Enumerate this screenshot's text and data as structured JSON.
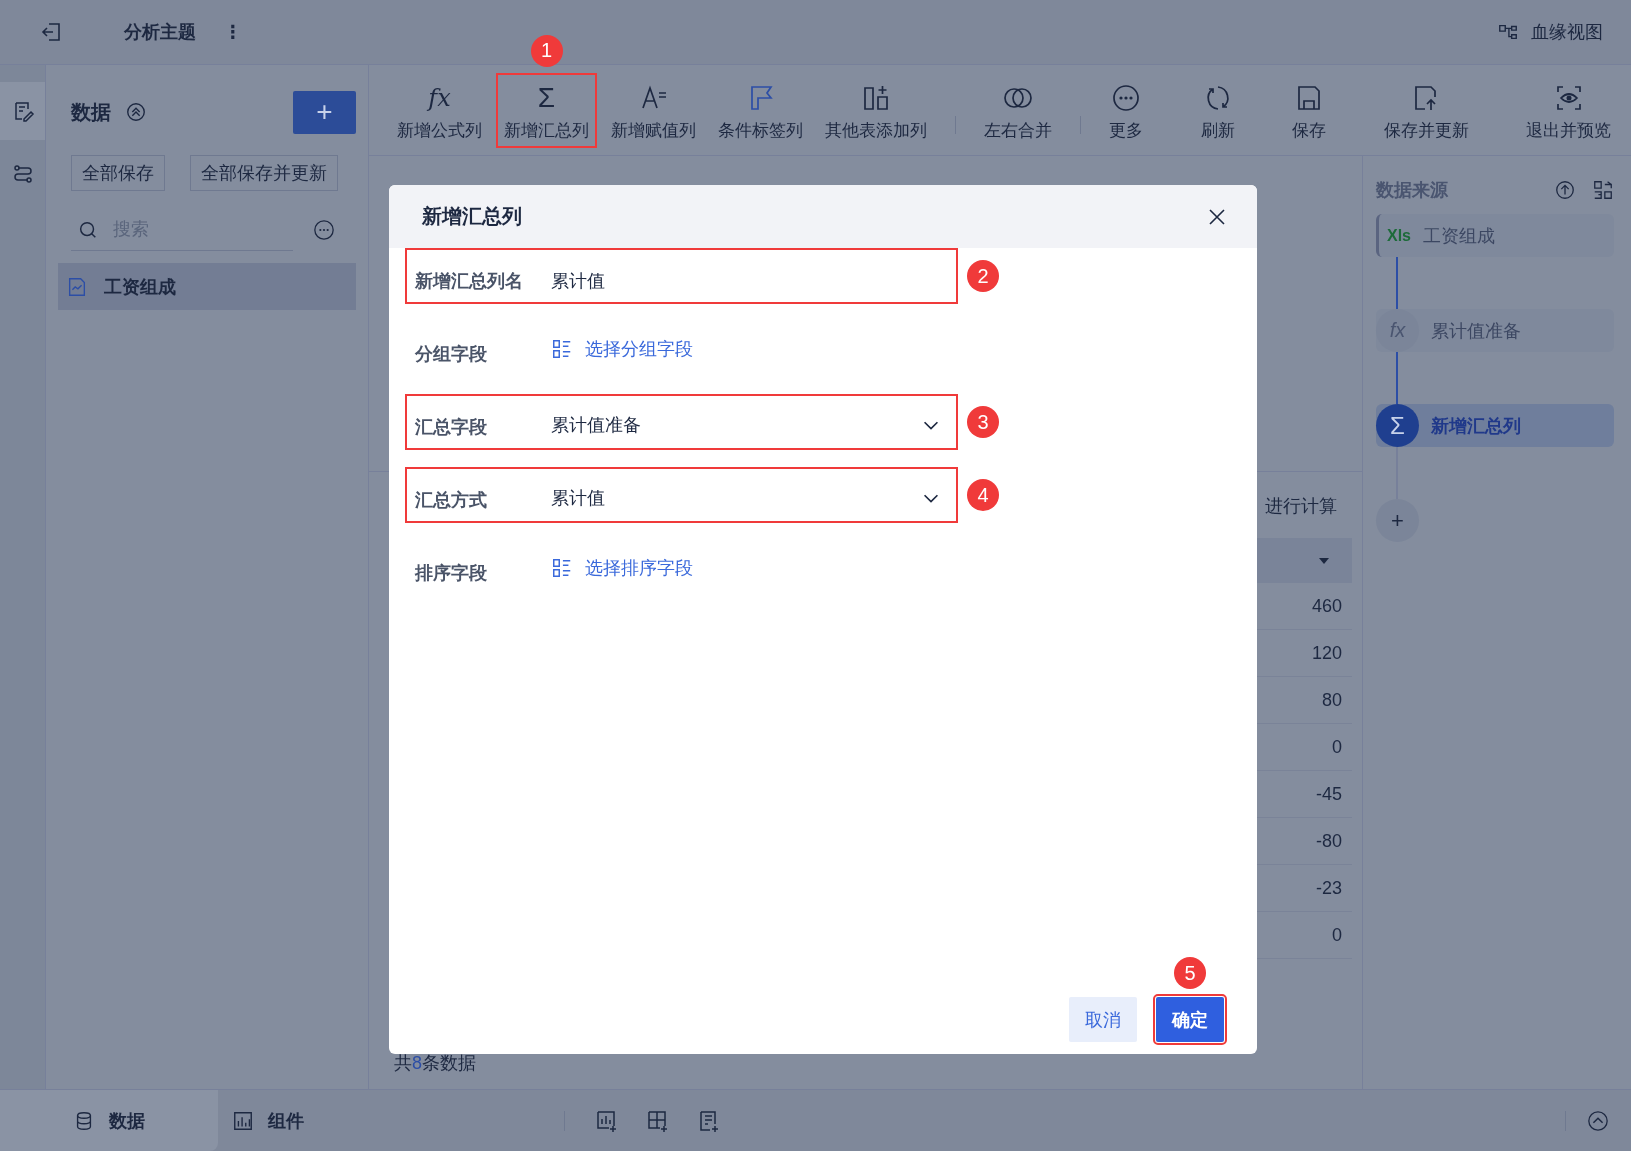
{
  "topbar": {
    "title": "分析主题",
    "menu_glyph": "⋮",
    "lineage_label": "血缘视图"
  },
  "rail": [
    {
      "kind": "edit",
      "selected": true
    },
    {
      "kind": "flow",
      "selected": false
    }
  ],
  "left_panel": {
    "title": "数据",
    "add_glyph": "+",
    "buttons": [
      "全部保存",
      "全部保存并更新"
    ],
    "search": {
      "placeholder": "搜索"
    },
    "items": [
      {
        "label": "工资组成",
        "selected": true
      }
    ]
  },
  "toolbar_groups": [
    {
      "items": [
        {
          "kind": "formula",
          "glyph": "fx",
          "label": "新增公式列"
        },
        {
          "kind": "sum",
          "glyph": "Σ",
          "label": "新增汇总列",
          "step": "1"
        },
        {
          "kind": "assign",
          "label": "新增赋值列"
        },
        {
          "kind": "tag",
          "label": "条件标签列"
        },
        {
          "kind": "other-table",
          "label": "其他表添加列"
        }
      ]
    },
    {
      "items": [
        {
          "kind": "merge",
          "label": "左右合并"
        }
      ]
    },
    {
      "items": [
        {
          "kind": "more",
          "label": "更多"
        },
        {
          "kind": "refresh",
          "label": "刷新"
        },
        {
          "kind": "save",
          "label": "保存"
        },
        {
          "kind": "save-update",
          "label": "保存并更新"
        },
        {
          "kind": "exit-preview",
          "label": "退出并预览"
        }
      ]
    }
  ],
  "main": {
    "note": "进行计算",
    "column_values": [
      "460",
      "120",
      "80",
      "0",
      "-45",
      "-80",
      "-23",
      "0"
    ],
    "footer": {
      "prefix": "共",
      "count": "8",
      "suffix": "条数据"
    }
  },
  "right_panel": {
    "title": "数据来源",
    "nodes": [
      {
        "kind": "source",
        "badge": "Xls",
        "label": "工资组成",
        "selected": false
      },
      {
        "kind": "step",
        "glyph": "fx",
        "label": "累计值准备",
        "selected": false
      },
      {
        "kind": "step",
        "glyph": "Σ",
        "label": "新增汇总列",
        "selected": true
      }
    ],
    "add_glyph": "+"
  },
  "dialog": {
    "title": "新增汇总列",
    "rows": [
      {
        "kind": "input",
        "label": "新增汇总列名",
        "value": "累计值",
        "step": "2"
      },
      {
        "kind": "picker",
        "label": "分组字段",
        "link": "选择分组字段"
      },
      {
        "kind": "select",
        "label": "汇总字段",
        "value": "累计值准备",
        "step": "3"
      },
      {
        "kind": "select",
        "label": "汇总方式",
        "value": "累计值",
        "step": "4"
      },
      {
        "kind": "picker",
        "label": "排序字段",
        "link": "选择排序字段"
      }
    ],
    "buttons": [
      {
        "kind": "secondary",
        "label": "取消"
      },
      {
        "kind": "primary",
        "label": "确定",
        "step": "5"
      }
    ]
  },
  "bottom_tabs": [
    {
      "kind": "database",
      "label": "数据",
      "selected": true
    },
    {
      "kind": "chart",
      "label": "组件",
      "selected": false
    }
  ]
}
